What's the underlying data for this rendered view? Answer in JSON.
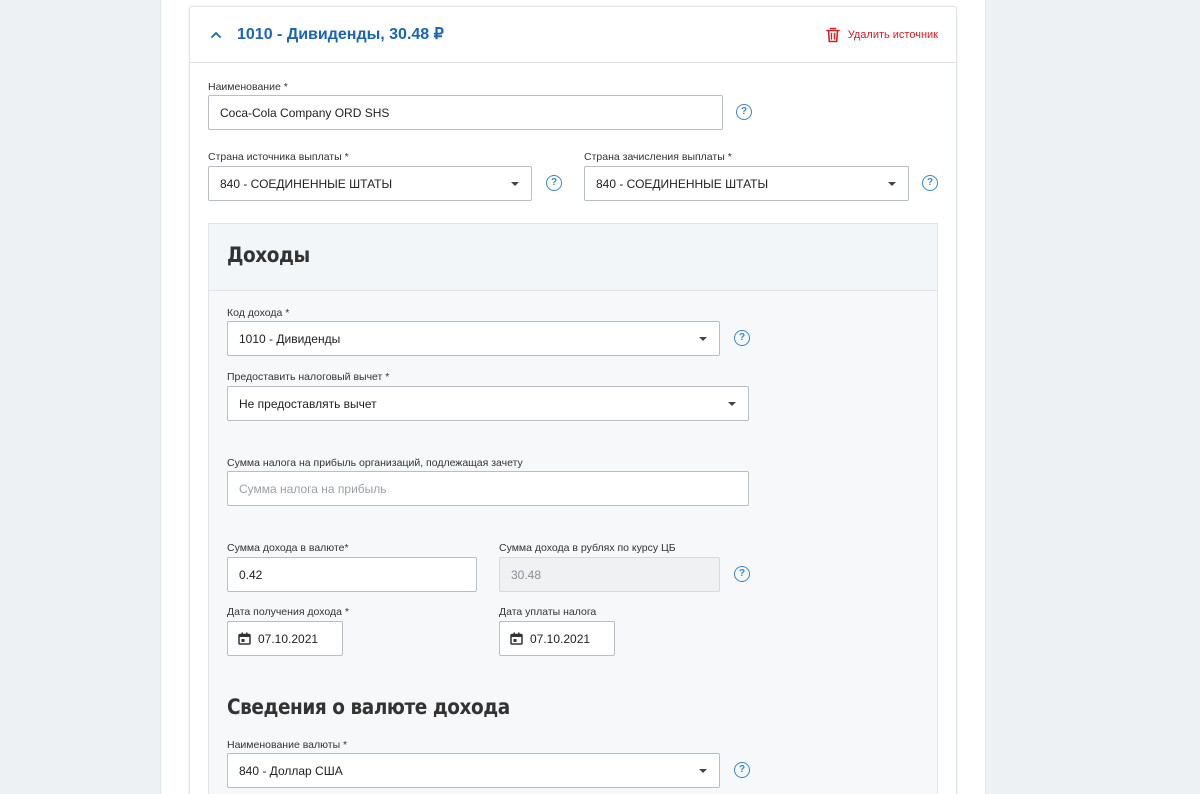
{
  "source": {
    "title": "1010 - Дивиденды, 30.48 ₽",
    "delete_label": "Удалить источник"
  },
  "name_field": {
    "label": "Наименование *",
    "value": "Coca-Cola Company ORD SHS"
  },
  "source_country": {
    "label": "Страна источника выплаты *",
    "value": "840 - СОЕДИНЕННЫЕ ШТАТЫ"
  },
  "credit_country": {
    "label": "Страна зачисления выплаты *",
    "value": "840 - СОЕДИНЕННЫЕ ШТАТЫ"
  },
  "income": {
    "section_title": "Доходы",
    "income_code": {
      "label": "Код дохода *",
      "value": "1010 - Дивиденды"
    },
    "tax_deduction": {
      "label": "Предоставить налоговый вычет *",
      "value": "Не предоставлять вычет"
    },
    "profit_tax": {
      "label": "Сумма налога на прибыль организаций, подлежащая зачету",
      "placeholder": "Сумма налога на прибыль"
    },
    "amount_currency": {
      "label": "Сумма дохода в валюте*",
      "value": "0.42"
    },
    "amount_rub": {
      "label": "Сумма дохода в рублях по курсу ЦБ",
      "value": "30.48"
    },
    "income_date": {
      "label": "Дата получения дохода *",
      "value": "07.10.2021"
    },
    "tax_date": {
      "label": "Дата уплаты налога",
      "value": "07.10.2021"
    }
  },
  "currency_info": {
    "section_title": "Сведения о валюте дохода",
    "currency_name": {
      "label": "Наименование валюты *",
      "value": "840 - Доллар США"
    }
  },
  "help_glyph": "?",
  "colors": {
    "accent": "#1a66b3",
    "danger": "#d0212a",
    "help": "#3a86c9"
  }
}
